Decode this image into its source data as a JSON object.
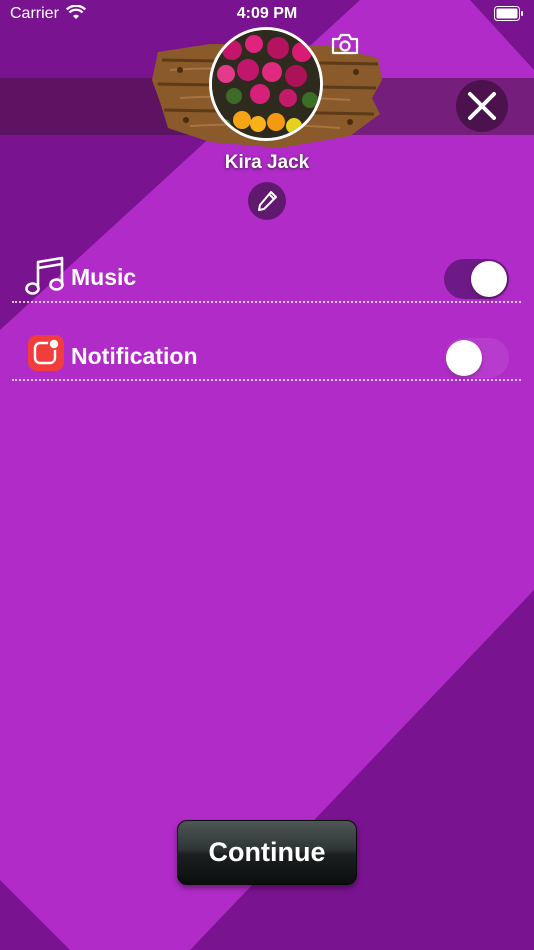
{
  "status_bar": {
    "carrier": "Carrier",
    "time": "4:09 PM"
  },
  "profile": {
    "name": "Kira Jack"
  },
  "settings": {
    "music": {
      "label": "Music",
      "enabled": true,
      "icon": "music-note-icon"
    },
    "notification": {
      "label": "Notification",
      "enabled": false,
      "icon": "notification-icon"
    }
  },
  "actions": {
    "continue_label": "Continue"
  },
  "colors": {
    "background": "#b12bc8",
    "dark_stripe": "#7a1390",
    "toggle_on": "#6e1a86",
    "notification_badge": "#f23d3d"
  }
}
